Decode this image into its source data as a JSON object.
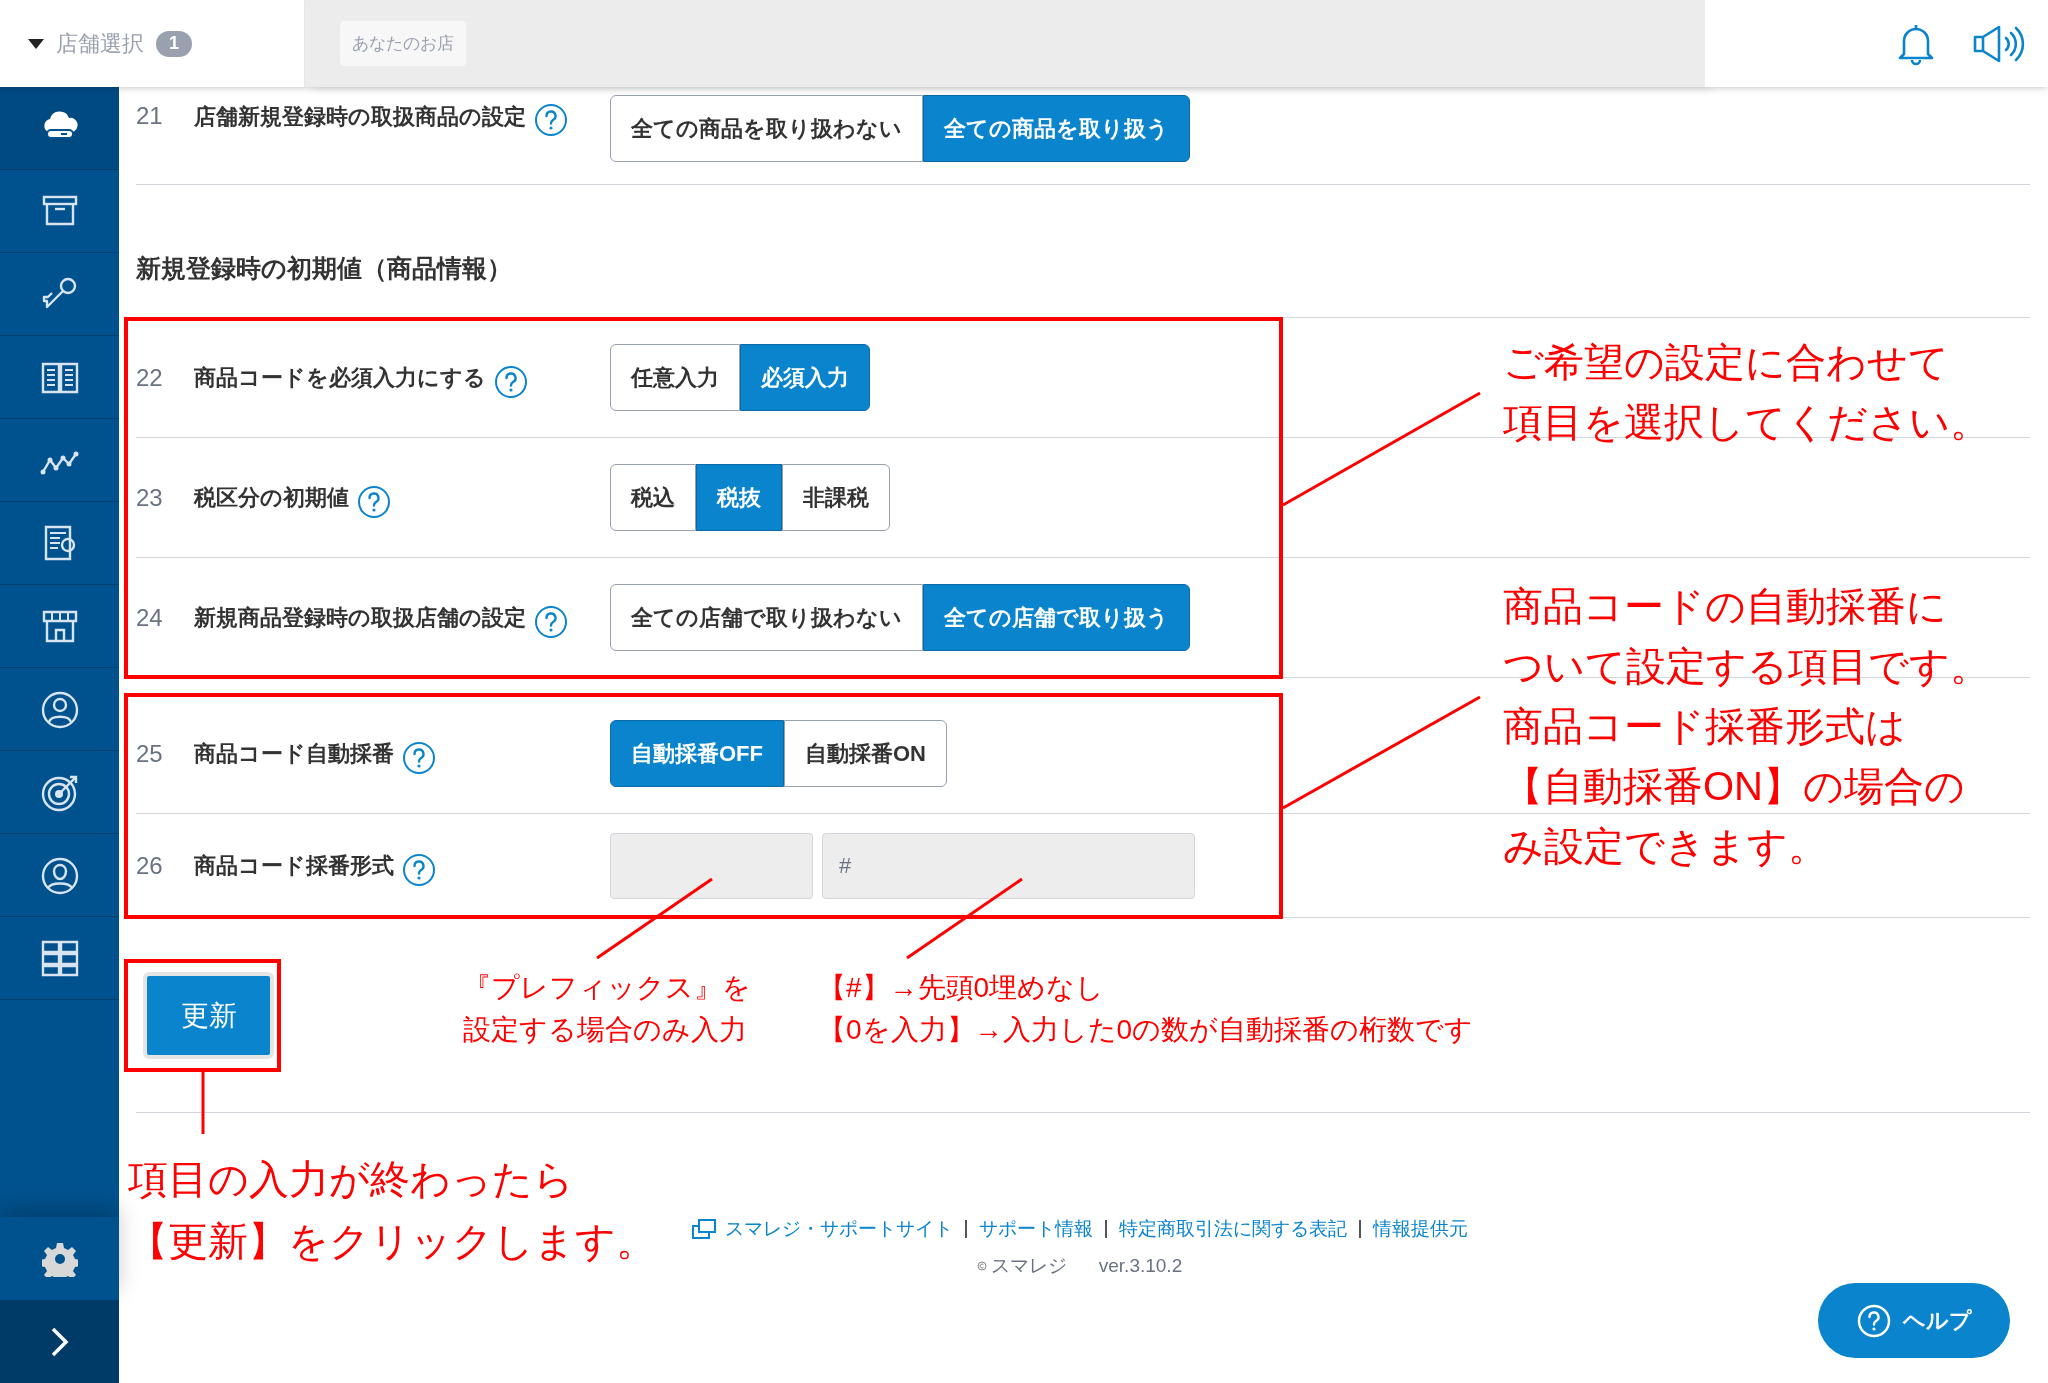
{
  "header": {
    "store_selector": {
      "label": "店舗選択",
      "count": "1",
      "expanded": true
    },
    "store_tag": "あなたのお店"
  },
  "sidebar": {
    "items": [
      {
        "kind": "cloud",
        "selected": true
      },
      {
        "kind": "box",
        "selected": false
      },
      {
        "kind": "key",
        "selected": false
      },
      {
        "kind": "book",
        "selected": false
      },
      {
        "kind": "chart",
        "selected": false
      },
      {
        "kind": "report",
        "selected": false
      },
      {
        "kind": "store",
        "selected": false
      },
      {
        "kind": "staff",
        "selected": false
      },
      {
        "kind": "target",
        "selected": false
      },
      {
        "kind": "customer",
        "selected": false
      },
      {
        "kind": "apps",
        "selected": false
      }
    ]
  },
  "settings": [
    {
      "number": "21",
      "label": "店舗新規登録時の取扱商品の設定",
      "kind": "options",
      "options": [
        {
          "label": "全ての商品を取り扱わない",
          "selected": false
        },
        {
          "label": "全ての商品を取り扱う",
          "selected": true
        }
      ]
    },
    {
      "kind": "heading",
      "label": "新規登録時の初期値（商品情報）"
    },
    {
      "number": "22",
      "label": "商品コードを必須入力にする",
      "kind": "options",
      "options": [
        {
          "label": "任意入力",
          "selected": false
        },
        {
          "label": "必須入力",
          "selected": true
        }
      ]
    },
    {
      "number": "23",
      "label": "税区分の初期値",
      "kind": "options",
      "options": [
        {
          "label": "税込",
          "selected": false
        },
        {
          "label": "税抜",
          "selected": true
        },
        {
          "label": "非課税",
          "selected": false
        }
      ]
    },
    {
      "number": "24",
      "label": "新規商品登録時の取扱店舗の設定",
      "kind": "options",
      "options": [
        {
          "label": "全ての店舗で取り扱わない",
          "selected": false
        },
        {
          "label": "全ての店舗で取り扱う",
          "selected": true
        }
      ]
    },
    {
      "number": "25",
      "label": "商品コード自動採番",
      "kind": "options",
      "options": [
        {
          "label": "自動採番OFF",
          "selected": true
        },
        {
          "label": "自動採番ON",
          "selected": false
        }
      ]
    },
    {
      "number": "26",
      "label": "商品コード採番形式",
      "kind": "fields",
      "fields": [
        {
          "disabled": true
        },
        {
          "value": "#",
          "disabled": true
        }
      ]
    }
  ],
  "update_button": "更新",
  "annotations": [
    {
      "lines": [
        "ご希望の設定に合わせて",
        "項目を選択してください。"
      ]
    },
    {
      "lines": [
        "商品コードの自動採番に",
        "ついて設定する項目です。",
        "商品コード採番形式は",
        "【自動採番ON】の場合の",
        "み設定できます。"
      ]
    },
    {
      "lines": [
        "『プレフィックス』を",
        "設定する場合のみ入力"
      ]
    },
    {
      "lines": [
        "【#】→先頭0埋めなし",
        "【0を入力】→入力した0の数が自動採番の桁数です"
      ]
    },
    {
      "lines": [
        "項目の入力が終わったら",
        "【更新】をクリックします。"
      ]
    }
  ],
  "footer": {
    "links": [
      "スマレジ・サポートサイト",
      "サポート情報",
      "特定商取引法に関する表記",
      "情報提供元"
    ],
    "copyright": "スマレジ",
    "version": "ver.3.10.2"
  },
  "help_button": "ヘルプ"
}
